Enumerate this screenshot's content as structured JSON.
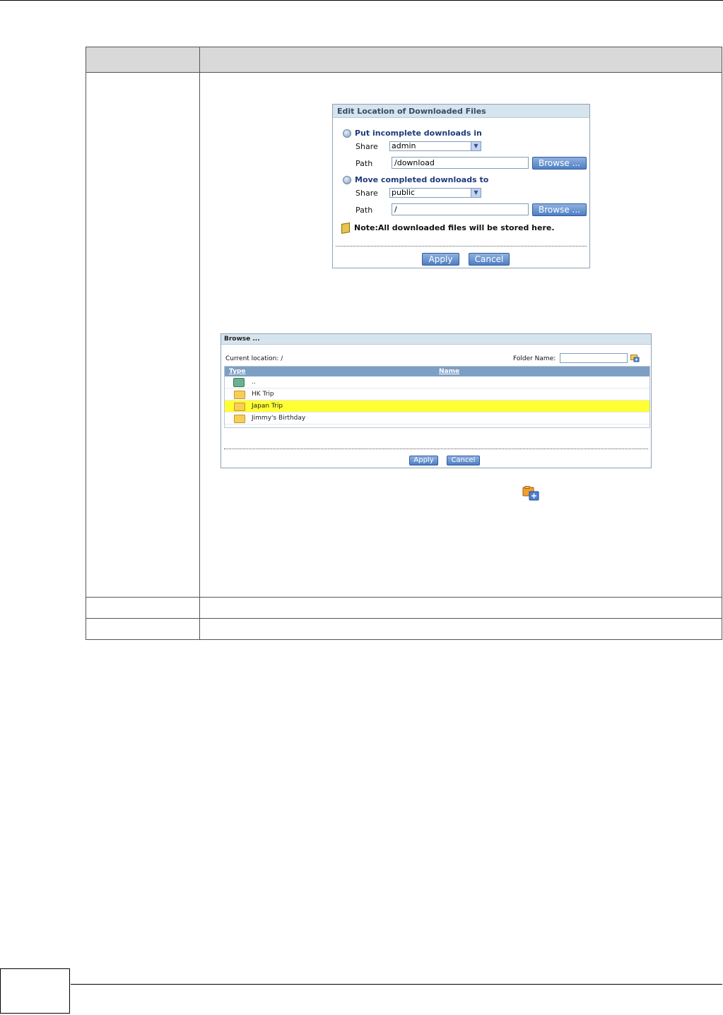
{
  "edit_dialog": {
    "title": "Edit Location of Downloaded Files",
    "incomplete_heading": "Put incomplete downloads in",
    "completed_heading": "Move completed downloads to",
    "share_label": "Share",
    "path_label": "Path",
    "incomplete_share": "admin",
    "incomplete_path": "/download",
    "completed_share": "public",
    "completed_path": "/",
    "browse_label": "Browse ...",
    "note": "Note:All downloaded files will be stored here.",
    "apply_label": "Apply",
    "cancel_label": "Cancel"
  },
  "browse_dialog": {
    "title": "Browse ...",
    "current_location": "Current location: /",
    "folder_name_label": "Folder Name:",
    "col_type": "Type",
    "col_name": "Name",
    "rows": [
      "..",
      "HK Trip",
      "Japan Trip",
      "Jimmy's Birthday"
    ],
    "selected_row": "Japan Trip",
    "apply_label": "Apply",
    "cancel_label": "Cancel"
  }
}
